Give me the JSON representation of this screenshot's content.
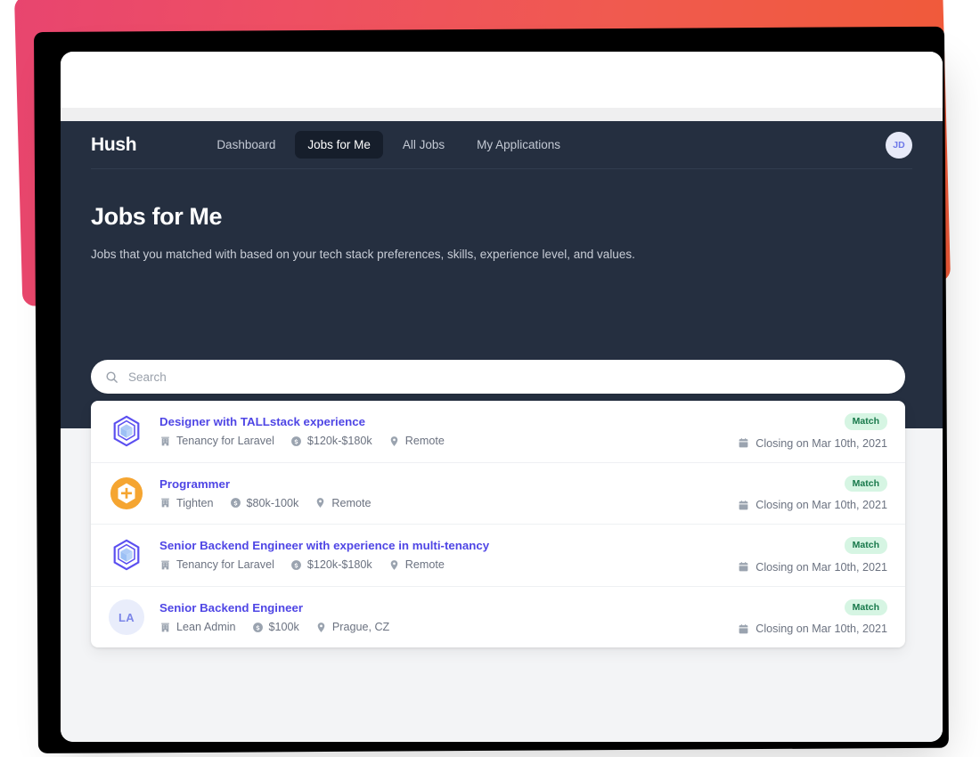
{
  "decor": {
    "gradient_from": "#e8456f",
    "gradient_to": "#f05a38",
    "shadow_color": "#000000"
  },
  "navbar": {
    "brand": "Hush",
    "links": [
      {
        "label": "Dashboard",
        "active": false
      },
      {
        "label": "Jobs for Me",
        "active": true
      },
      {
        "label": "All Jobs",
        "active": false
      },
      {
        "label": "My Applications",
        "active": false
      }
    ],
    "avatar_initials": "JD"
  },
  "hero": {
    "title": "Jobs for Me",
    "subtitle": "Jobs that you matched with based on your tech stack preferences, skills, experience level, and values.",
    "background": "#252f40"
  },
  "search": {
    "value": "",
    "placeholder": "Search",
    "icon": "search-icon"
  },
  "jobs": [
    {
      "logo_type": "hex-cube",
      "title": "Designer with TALLstack experience",
      "company": "Tenancy for Laravel",
      "salary": "$120k-$180k",
      "location": "Remote",
      "badge": "Match",
      "closing": "Closing on Mar 10th, 2021"
    },
    {
      "logo_type": "orange-plus",
      "title": "Programmer",
      "company": "Tighten",
      "salary": "$80k-100k",
      "location": "Remote",
      "badge": "Match",
      "closing": "Closing on Mar 10th, 2021"
    },
    {
      "logo_type": "hex-cube",
      "title": "Senior Backend Engineer with experience in multi-tenancy",
      "company": "Tenancy for Laravel",
      "salary": "$120k-$180k",
      "location": "Remote",
      "badge": "Match",
      "closing": "Closing on Mar 10th, 2021"
    },
    {
      "logo_type": "initials",
      "logo_initials": "LA",
      "title": "Senior Backend Engineer",
      "company": "Lean Admin",
      "salary": "$100k",
      "location": "Prague, CZ",
      "badge": "Match",
      "closing": "Closing on Mar 10th, 2021"
    }
  ],
  "colors": {
    "accent": "#4f46e5",
    "badge_bg": "#d6f5e3",
    "badge_text": "#17784a",
    "muted_text": "#6b7280"
  }
}
